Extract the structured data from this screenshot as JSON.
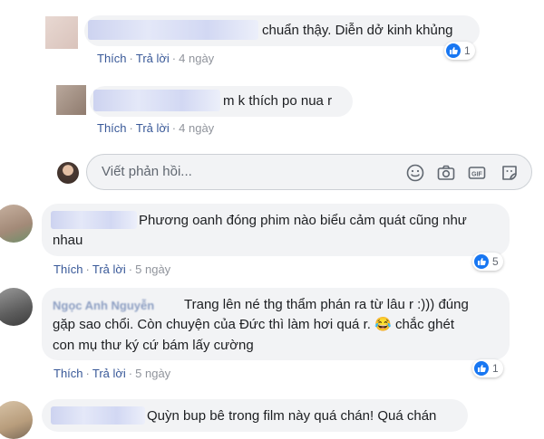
{
  "comments": [
    {
      "text": "chuẩn thậy. Diễn dở kinh khủng",
      "actions": {
        "like": "Thích",
        "reply": "Trả lời",
        "time": "4 ngày"
      },
      "reactions": {
        "count": "1"
      }
    },
    {
      "text": "m k thích po nua r",
      "actions": {
        "like": "Thích",
        "reply": "Trả lời",
        "time": "4 ngày"
      }
    },
    {
      "text_line1": "Phương oanh đóng phim nào biểu cảm quát cũng như",
      "text_line2": "nhau",
      "actions": {
        "like": "Thích",
        "reply": "Trả lời",
        "time": "5 ngày"
      },
      "reactions": {
        "count": "5"
      }
    },
    {
      "author": "Ngọc Anh Nguyễn",
      "text_line1": "Trang lên né thg thẩm phán ra từ lâu r :))) đúng",
      "text_line2a": "gặp sao chổi. Còn chuyện của Đức thì làm hơi quá r.",
      "emoji": "😂",
      "text_line2b": "chắc ghét",
      "text_line3": "con mụ thư ký cứ bám lấy cường",
      "actions": {
        "like": "Thích",
        "reply": "Trả lời",
        "time": "5 ngày"
      },
      "reactions": {
        "count": "1"
      }
    },
    {
      "text": "Quỳn bup bê trong film này quá chán! Quá chán"
    }
  ],
  "reply_box": {
    "placeholder": "Viết phản hồi...",
    "icons": [
      "smiley-icon",
      "camera-icon",
      "gif-icon",
      "sticker-icon"
    ]
  },
  "colors": {
    "link": "#385898",
    "bubble": "#f2f3f5",
    "like_blue": "#1877f2",
    "meta": "#90949c"
  }
}
